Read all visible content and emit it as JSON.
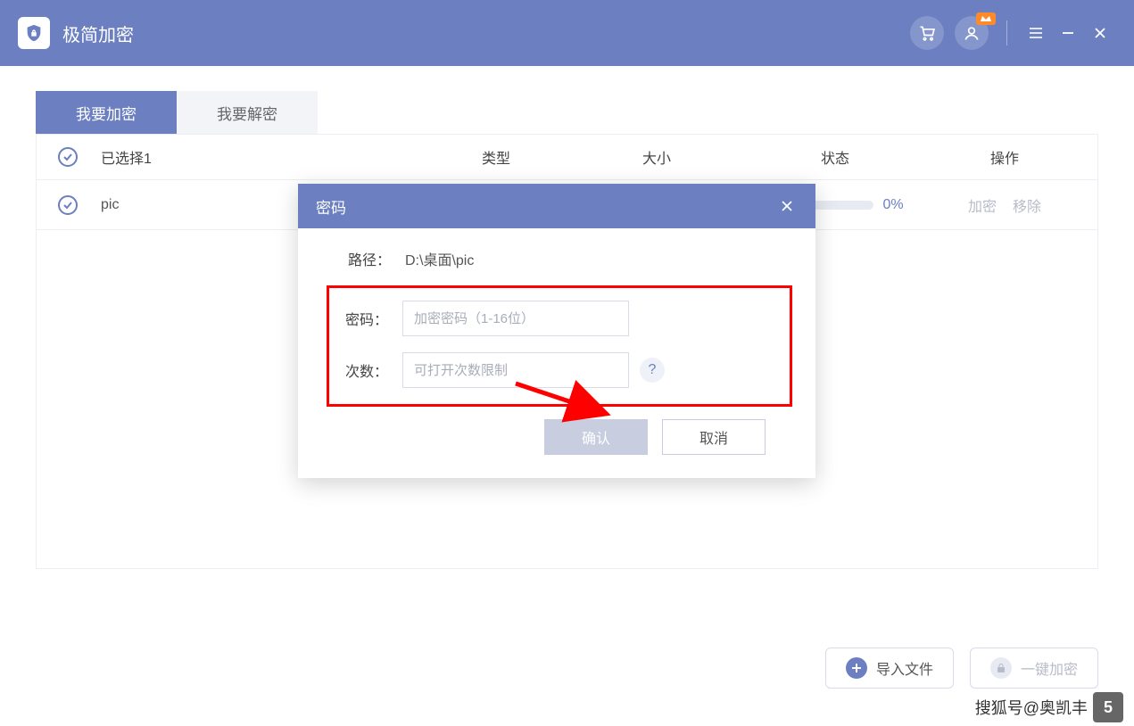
{
  "app": {
    "title": "极简加密"
  },
  "tabs": {
    "encrypt": "我要加密",
    "decrypt": "我要解密"
  },
  "table": {
    "header": {
      "selected": "已选择1",
      "type": "类型",
      "size": "大小",
      "status": "状态",
      "ops": "操作"
    },
    "row": {
      "name": "pic",
      "percent": "0%",
      "op_encrypt": "加密",
      "op_remove": "移除"
    }
  },
  "bottom": {
    "import": "导入文件",
    "encrypt_all": "一键加密"
  },
  "dialog": {
    "title": "密码",
    "path_label": "路径：",
    "path_value": "D:\\桌面\\pic",
    "password_label": "密码：",
    "password_placeholder": "加密密码（1-16位）",
    "count_label": "次数：",
    "count_placeholder": "可打开次数限制",
    "help": "?",
    "confirm": "确认",
    "cancel": "取消"
  },
  "watermark": {
    "text": "搜狐号@奥凯丰",
    "logo": "5"
  }
}
